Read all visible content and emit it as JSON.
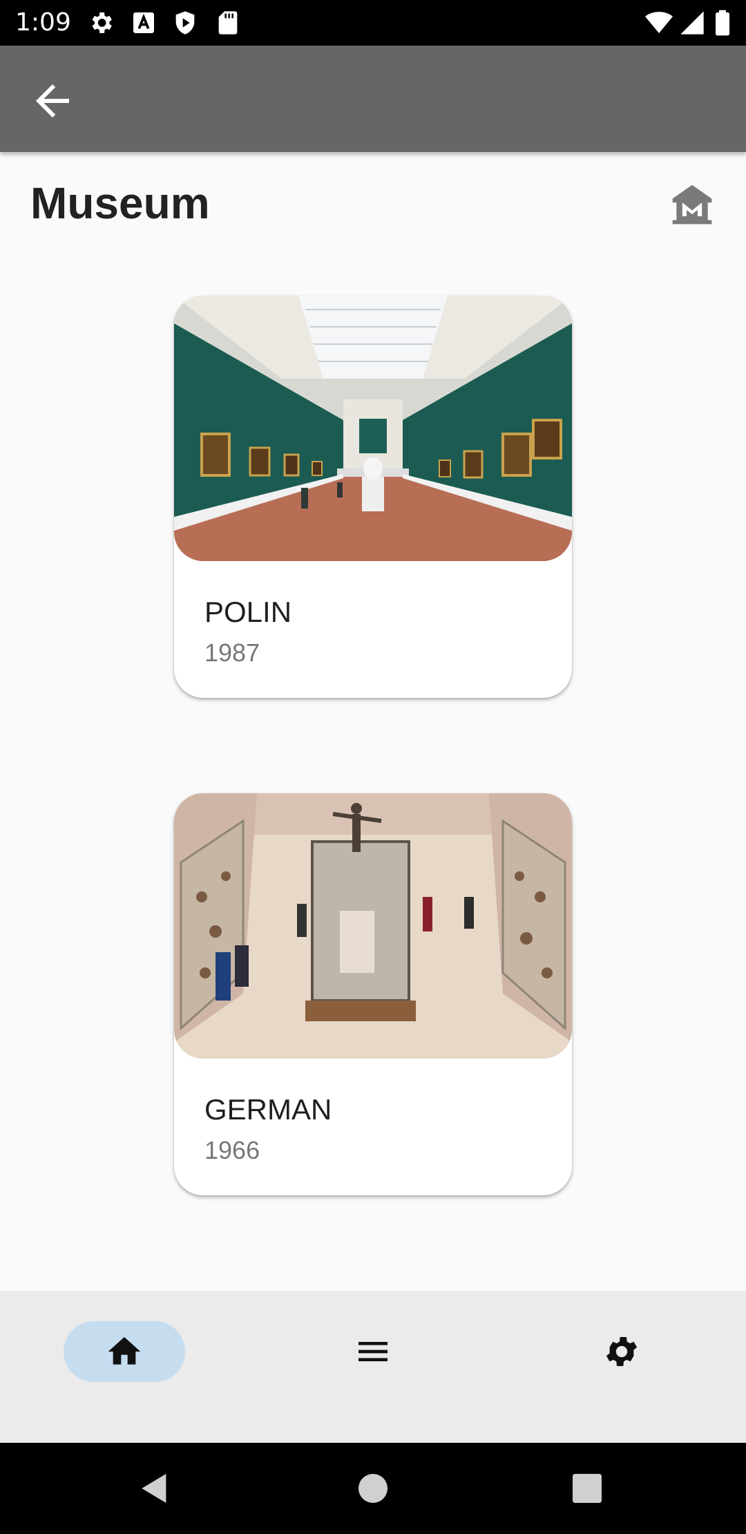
{
  "status_bar": {
    "time": "1:09",
    "icons": [
      "settings-icon",
      "a-icon",
      "play-protect-icon",
      "sd-card-icon",
      "wifi-icon",
      "signal-icon",
      "battery-icon"
    ]
  },
  "app_bar": {
    "back_icon": "arrow-back-icon"
  },
  "header": {
    "title": "Museum",
    "icon": "museum-icon"
  },
  "museums": [
    {
      "name": "POLIN",
      "year": "1987"
    },
    {
      "name": "GERMAN",
      "year": "1966"
    }
  ],
  "bottom_nav": {
    "items": [
      {
        "icon": "home-icon",
        "active": true
      },
      {
        "icon": "menu-icon",
        "active": false
      },
      {
        "icon": "settings-icon",
        "active": false
      }
    ],
    "active_color": "#c6dcef"
  },
  "system_nav": {
    "items": [
      "back-icon",
      "home-circle-icon",
      "recents-icon"
    ]
  },
  "colors": {
    "app_bar": "#666666",
    "background": "#fafafa",
    "nav_bar": "#ebebeb"
  }
}
